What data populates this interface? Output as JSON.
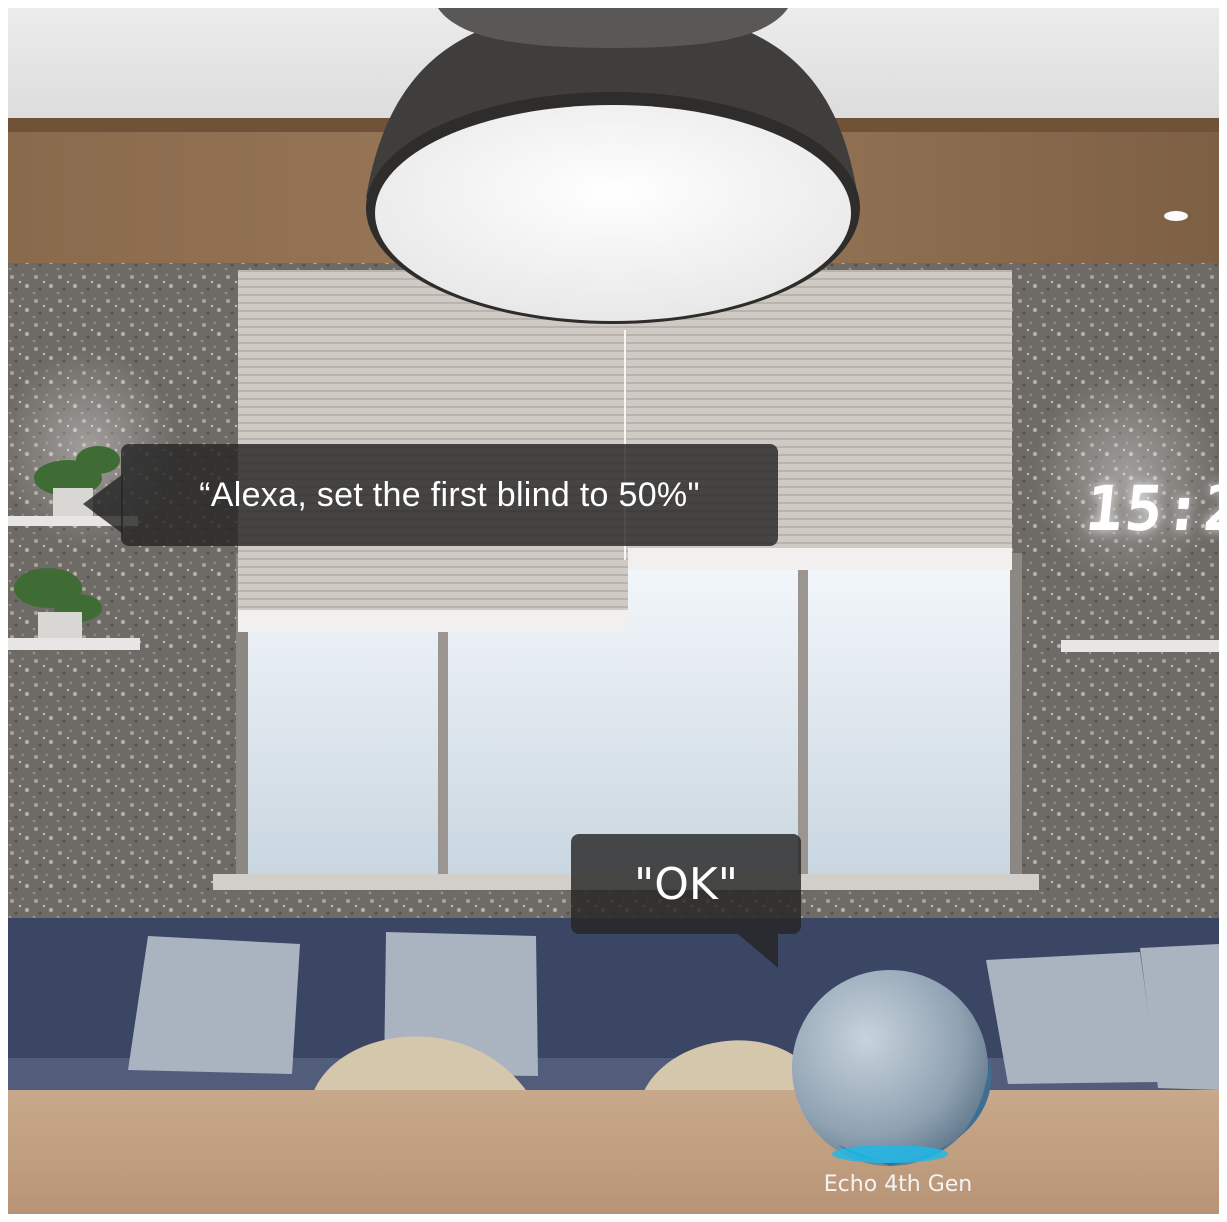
{
  "scene": {
    "alexa_command": "“Alexa, set the first blind to 50%\"",
    "alexa_reply": "\"OK\"",
    "device_caption": "Echo 4th Gen",
    "wall_clock": "15:2",
    "colors": {
      "bubble": "#262626",
      "accent_ring": "#1fb8e6",
      "sofa": "#3b4564",
      "table": "#c9a789"
    }
  }
}
